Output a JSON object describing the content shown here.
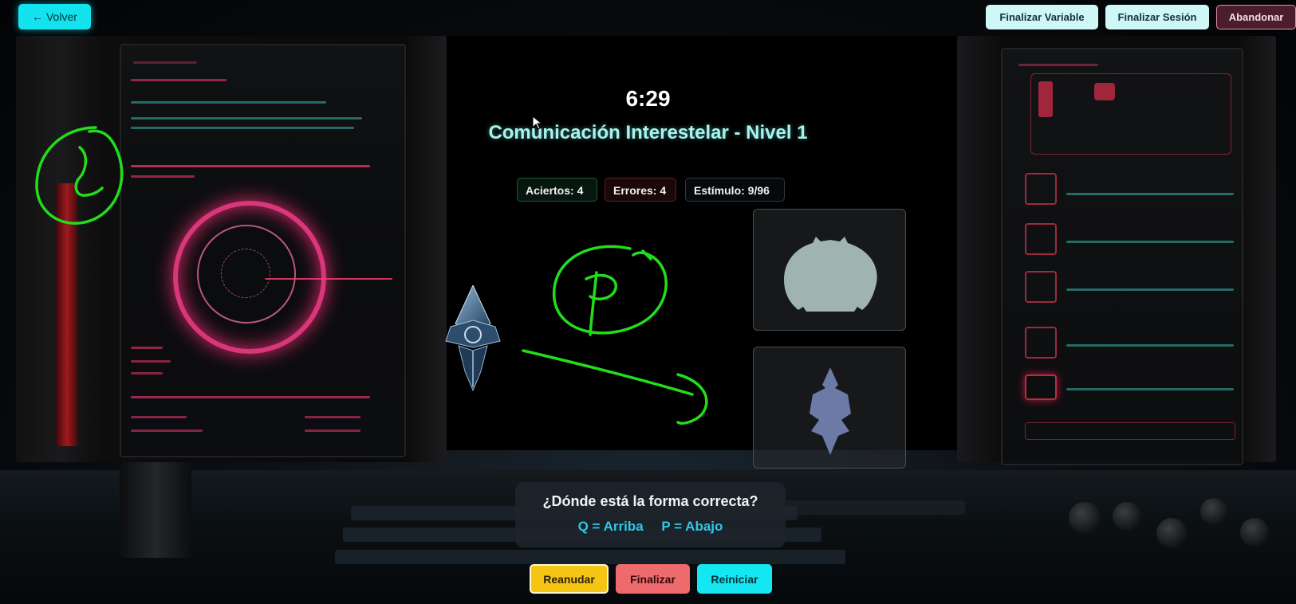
{
  "topbar": {
    "back_label": "← Volver",
    "finalize_variable_label": "Finalizar Variable",
    "finalize_session_label": "Finalizar Sesión",
    "abandon_label": "Abandonar"
  },
  "game": {
    "timer": "6:29",
    "title": "Comunicación Interestelar - Nivel 1",
    "stats": {
      "hits": "Aciertos: 4",
      "errors": "Errores: 4",
      "stimulus": "Estímulo: 9/96"
    },
    "prompt": {
      "question": "¿Dónde está la forma correcta?",
      "key_up": "Q = Arriba",
      "key_down": "P = Abajo"
    },
    "controls": {
      "resume_label": "Reanudar",
      "finish_label": "Finalizar",
      "restart_label": "Reiniciar"
    }
  },
  "annotations": {
    "left_mark": "L",
    "center_mark": "P"
  },
  "colors": {
    "accent_cyan": "#12e3ef",
    "title_cyan": "#a6f4ee",
    "resume_yellow": "#f5c516",
    "finish_red": "#ef6a6c",
    "annotation_green": "#22dd1a"
  },
  "icons": {
    "ship": "crystal-ship-icon",
    "top_shape": "blob-shape-icon",
    "bottom_shape": "spike-shape-icon"
  }
}
